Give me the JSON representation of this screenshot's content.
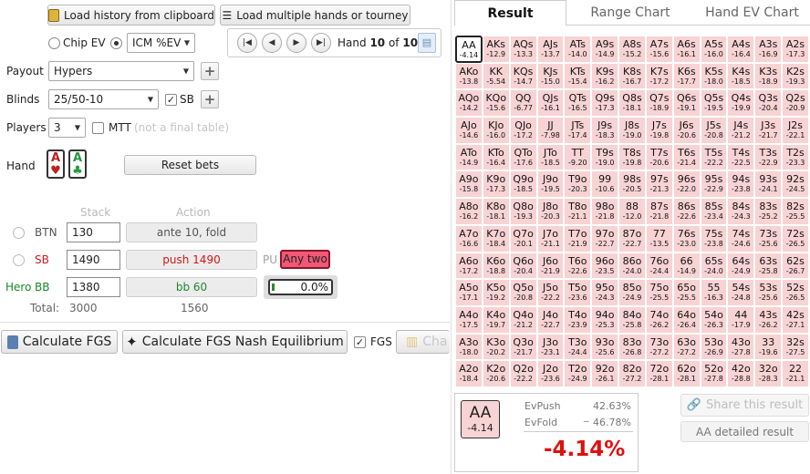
{
  "toolbar": {
    "load_history": "Load history from clipboard",
    "load_multiple": "Load multiple hands or tourney"
  },
  "ev_mode": {
    "chip_ev": "Chip EV",
    "icm_select": "ICM %EV"
  },
  "hand_nav": {
    "hand_label": "Hand",
    "current": "10",
    "of": "of",
    "total": "10"
  },
  "payout": {
    "label": "Payout",
    "value": "Hypers"
  },
  "blinds": {
    "label": "Blinds",
    "value": "25/50-10",
    "sb_checkbox": "SB"
  },
  "players": {
    "label": "Players",
    "value": "3",
    "mtt": "MTT",
    "mtt_note": "(not a final table)"
  },
  "hand": {
    "label": "Hand",
    "card1_rank": "A",
    "card1_suit": "♥",
    "card2_rank": "A",
    "card2_suit": "♣",
    "reset_bets": "Reset bets"
  },
  "table_headers": {
    "stack": "Stack",
    "action": "Action"
  },
  "seats": [
    {
      "pos": "BTN",
      "stack": "130",
      "action": "ante 10, fold"
    },
    {
      "pos": "SB",
      "stack": "1490",
      "action": "push 1490",
      "tag": "PU",
      "range": "Any two"
    },
    {
      "hero": "Hero",
      "pos": "BB",
      "stack": "1380",
      "action": "bb 60",
      "pct": "0.0%"
    }
  ],
  "totals": {
    "label": "Total:",
    "stack": "3000",
    "action": "1560"
  },
  "bottom": {
    "calc": "Calculate FGS",
    "nash": "Calculate FGS Nash Equilibrium",
    "fgs": "FGS",
    "chart": "Cha"
  },
  "tabs": [
    "Result",
    "Range Chart",
    "Hand EV Chart"
  ],
  "grid": [
    [
      [
        "AA",
        "-4.14"
      ],
      [
        "AKs",
        "-12.9"
      ],
      [
        "AQs",
        "-13.3"
      ],
      [
        "AJs",
        "-13.7"
      ],
      [
        "ATs",
        "-14.0"
      ],
      [
        "A9s",
        "-14.9"
      ],
      [
        "A8s",
        "-15.2"
      ],
      [
        "A7s",
        "-15.6"
      ],
      [
        "A6s",
        "-16.1"
      ],
      [
        "A5s",
        "-16.0"
      ],
      [
        "A4s",
        "-16.4"
      ],
      [
        "A3s",
        "-16.9"
      ],
      [
        "A2s",
        "-17.3"
      ]
    ],
    [
      [
        "AKo",
        "-13.8"
      ],
      [
        "KK",
        "-5.54"
      ],
      [
        "KQs",
        "-14.7"
      ],
      [
        "KJs",
        "-15.0"
      ],
      [
        "KTs",
        "-15.4"
      ],
      [
        "K9s",
        "-16.2"
      ],
      [
        "K8s",
        "-16.7"
      ],
      [
        "K7s",
        "-17.2"
      ],
      [
        "K6s",
        "-17.7"
      ],
      [
        "K5s",
        "-18.0"
      ],
      [
        "K4s",
        "-18.5"
      ],
      [
        "K3s",
        "-18.9"
      ],
      [
        "K2s",
        "-19.3"
      ]
    ],
    [
      [
        "AQo",
        "-14.2"
      ],
      [
        "KQo",
        "-15.6"
      ],
      [
        "QQ",
        "-6.77"
      ],
      [
        "QJs",
        "-16.1"
      ],
      [
        "QTs",
        "-16.5"
      ],
      [
        "Q9s",
        "-17.3"
      ],
      [
        "Q8s",
        "-18.1"
      ],
      [
        "Q7s",
        "-18.9"
      ],
      [
        "Q6s",
        "-19.1"
      ],
      [
        "Q5s",
        "-19.5"
      ],
      [
        "Q4s",
        "-19.9"
      ],
      [
        "Q3s",
        "-20.4"
      ],
      [
        "Q2s",
        "-20.9"
      ]
    ],
    [
      [
        "AJo",
        "-14.6"
      ],
      [
        "KJo",
        "-16.0"
      ],
      [
        "QJo",
        "-17.2"
      ],
      [
        "JJ",
        "-7.98"
      ],
      [
        "JTs",
        "-17.4"
      ],
      [
        "J9s",
        "-18.3"
      ],
      [
        "J8s",
        "-19.0"
      ],
      [
        "J7s",
        "-19.8"
      ],
      [
        "J6s",
        "-20.6"
      ],
      [
        "J5s",
        "-20.8"
      ],
      [
        "J4s",
        "-21.2"
      ],
      [
        "J3s",
        "-21.7"
      ],
      [
        "J2s",
        "-22.1"
      ]
    ],
    [
      [
        "ATo",
        "-14.9"
      ],
      [
        "KTo",
        "-16.4"
      ],
      [
        "QTo",
        "-17.6"
      ],
      [
        "JTo",
        "-18.5"
      ],
      [
        "TT",
        "-9.20"
      ],
      [
        "T9s",
        "-19.0"
      ],
      [
        "T8s",
        "-19.8"
      ],
      [
        "T7s",
        "-20.6"
      ],
      [
        "T6s",
        "-21.4"
      ],
      [
        "T5s",
        "-22.2"
      ],
      [
        "T4s",
        "-22.5"
      ],
      [
        "T3s",
        "-22.9"
      ],
      [
        "T2s",
        "-23.3"
      ]
    ],
    [
      [
        "A9o",
        "-15.8"
      ],
      [
        "K9o",
        "-17.3"
      ],
      [
        "Q9o",
        "-18.5"
      ],
      [
        "J9o",
        "-19.5"
      ],
      [
        "T9o",
        "-20.3"
      ],
      [
        "99",
        "-10.6"
      ],
      [
        "98s",
        "-20.5"
      ],
      [
        "97s",
        "-21.3"
      ],
      [
        "96s",
        "-22.0"
      ],
      [
        "95s",
        "-22.9"
      ],
      [
        "94s",
        "-23.8"
      ],
      [
        "93s",
        "-24.1"
      ],
      [
        "92s",
        "-24.5"
      ]
    ],
    [
      [
        "A8o",
        "-16.2"
      ],
      [
        "K8o",
        "-18.1"
      ],
      [
        "Q8o",
        "-19.3"
      ],
      [
        "J8o",
        "-20.3"
      ],
      [
        "T8o",
        "-21.1"
      ],
      [
        "98o",
        "-21.8"
      ],
      [
        "88",
        "-12.0"
      ],
      [
        "87s",
        "-21.8"
      ],
      [
        "86s",
        "-22.6"
      ],
      [
        "85s",
        "-23.4"
      ],
      [
        "84s",
        "-24.3"
      ],
      [
        "83s",
        "-25.2"
      ],
      [
        "82s",
        "-25.5"
      ]
    ],
    [
      [
        "A7o",
        "-16.6"
      ],
      [
        "K7o",
        "-18.4"
      ],
      [
        "Q7o",
        "-20.1"
      ],
      [
        "J7o",
        "-21.1"
      ],
      [
        "T7o",
        "-21.9"
      ],
      [
        "97o",
        "-22.7"
      ],
      [
        "87o",
        "-22.7"
      ],
      [
        "77",
        "-13.5"
      ],
      [
        "76s",
        "-23.0"
      ],
      [
        "75s",
        "-23.8"
      ],
      [
        "74s",
        "-24.6"
      ],
      [
        "73s",
        "-25.6"
      ],
      [
        "72s",
        "-26.5"
      ]
    ],
    [
      [
        "A6o",
        "-17.2"
      ],
      [
        "K6o",
        "-18.8"
      ],
      [
        "Q6o",
        "-20.4"
      ],
      [
        "J6o",
        "-21.9"
      ],
      [
        "T6o",
        "-22.6"
      ],
      [
        "96o",
        "-23.5"
      ],
      [
        "86o",
        "-24.0"
      ],
      [
        "76o",
        "-24.4"
      ],
      [
        "66",
        "-14.9"
      ],
      [
        "65s",
        "-24.0"
      ],
      [
        "64s",
        "-24.9"
      ],
      [
        "63s",
        "-25.8"
      ],
      [
        "62s",
        "-26.7"
      ]
    ],
    [
      [
        "A5o",
        "-17.1"
      ],
      [
        "K5o",
        "-19.2"
      ],
      [
        "Q5o",
        "-20.8"
      ],
      [
        "J5o",
        "-22.2"
      ],
      [
        "T5o",
        "-23.6"
      ],
      [
        "95o",
        "-24.3"
      ],
      [
        "85o",
        "-24.9"
      ],
      [
        "75o",
        "-25.5"
      ],
      [
        "65o",
        "-25.5"
      ],
      [
        "55",
        "-16.3"
      ],
      [
        "54s",
        "-24.8"
      ],
      [
        "53s",
        "-25.6"
      ],
      [
        "52s",
        "-26.5"
      ]
    ],
    [
      [
        "A4o",
        "-17.5"
      ],
      [
        "K4o",
        "-19.7"
      ],
      [
        "Q4o",
        "-21.2"
      ],
      [
        "J4o",
        "-22.7"
      ],
      [
        "T4o",
        "-23.9"
      ],
      [
        "94o",
        "-25.3"
      ],
      [
        "84o",
        "-25.8"
      ],
      [
        "74o",
        "-26.2"
      ],
      [
        "64o",
        "-26.4"
      ],
      [
        "54o",
        "-26.3"
      ],
      [
        "44",
        "-17.9"
      ],
      [
        "43s",
        "-26.2"
      ],
      [
        "42s",
        "-27.1"
      ]
    ],
    [
      [
        "A3o",
        "-18.0"
      ],
      [
        "K3o",
        "-20.2"
      ],
      [
        "Q3o",
        "-21.7"
      ],
      [
        "J3o",
        "-23.1"
      ],
      [
        "T3o",
        "-24.4"
      ],
      [
        "93o",
        "-25.6"
      ],
      [
        "83o",
        "-26.8"
      ],
      [
        "73o",
        "-27.2"
      ],
      [
        "63o",
        "-27.2"
      ],
      [
        "53o",
        "-26.9"
      ],
      [
        "43o",
        "-27.8"
      ],
      [
        "33",
        "-19.6"
      ],
      [
        "32s",
        "-27.5"
      ]
    ],
    [
      [
        "A2o",
        "-18.4"
      ],
      [
        "K2o",
        "-20.6"
      ],
      [
        "Q2o",
        "-22.2"
      ],
      [
        "J2o",
        "-23.6"
      ],
      [
        "T2o",
        "-24.9"
      ],
      [
        "92o",
        "-26.1"
      ],
      [
        "82o",
        "-27.2"
      ],
      [
        "72o",
        "-28.1"
      ],
      [
        "62o",
        "-28.1"
      ],
      [
        "52o",
        "-27.8"
      ],
      [
        "42o",
        "-28.8"
      ],
      [
        "32o",
        "-28.3"
      ],
      [
        "22",
        "-21.1"
      ]
    ]
  ],
  "result": {
    "hand": "AA",
    "hand_ev": "-4.14",
    "ev_push_label": "EvPush",
    "ev_push": "42.63%",
    "ev_fold_label": "EvFold",
    "ev_fold": "46.78%",
    "dash": "_",
    "diff": "-4.14%"
  },
  "share": {
    "share_btn": "Share this result",
    "detail_btn": "AA detailed result"
  }
}
